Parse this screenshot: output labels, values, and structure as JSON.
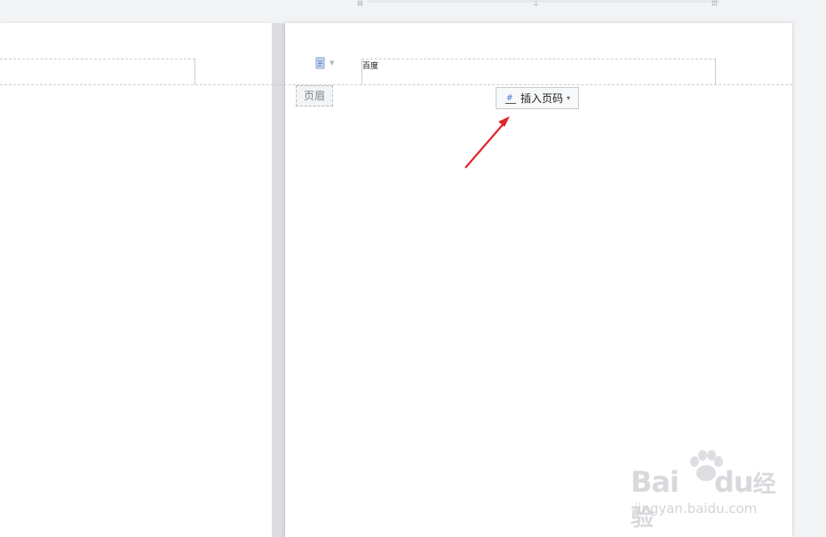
{
  "document": {
    "header_text": "百度",
    "header_label": "页眉"
  },
  "toolbar": {
    "insert_page_number_label": "插入页码"
  },
  "watermark": {
    "main_latin": "Bai",
    "main_latin_2": "du",
    "main_cn": "经验",
    "sub": "jingyan.baidu.com"
  },
  "colors": {
    "annotation_arrow": "#e0242b",
    "page_background": "#ffffff",
    "canvas_background": "#f2f3f5"
  }
}
